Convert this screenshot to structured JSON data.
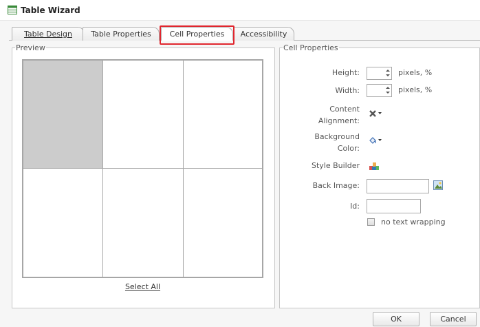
{
  "window": {
    "title": "Table Wizard"
  },
  "tabs": [
    {
      "label": "Table Design",
      "selected": false
    },
    {
      "label": "Table Properties",
      "selected": false
    },
    {
      "label": "Cell Properties",
      "selected": true
    },
    {
      "label": "Accessibility",
      "selected": false
    }
  ],
  "preview": {
    "legend": "Preview",
    "select_all": "Select All",
    "rows": 2,
    "columns": 3,
    "selected_cell": "row 1, column 1"
  },
  "cell_properties": {
    "legend": "Cell Properties",
    "height_label": "Height:",
    "height_value": "",
    "height_unit": "pixels, %",
    "width_label": "Width:",
    "width_value": "",
    "width_unit": "pixels, %",
    "content_alignment_label_1": "Content",
    "content_alignment_label_2": "Alignment:",
    "background_color_label_1": "Background",
    "background_color_label_2": "Color:",
    "style_builder_label": "Style Builder",
    "back_image_label": "Back Image:",
    "back_image_value": "",
    "id_label": "Id:",
    "id_value": "",
    "no_wrap_label": "no text wrapping",
    "no_wrap_checked": false
  },
  "buttons": {
    "ok": "OK",
    "cancel": "Cancel"
  },
  "icons": {
    "title": "table-icon",
    "alignment": "alignment-picker-icon",
    "color": "paint-bucket-icon",
    "style_builder": "style-builder-icon",
    "image_browse": "image-browse-icon"
  },
  "colors": {
    "highlight": "#e0262e",
    "selected_cell": "#cccccc"
  }
}
